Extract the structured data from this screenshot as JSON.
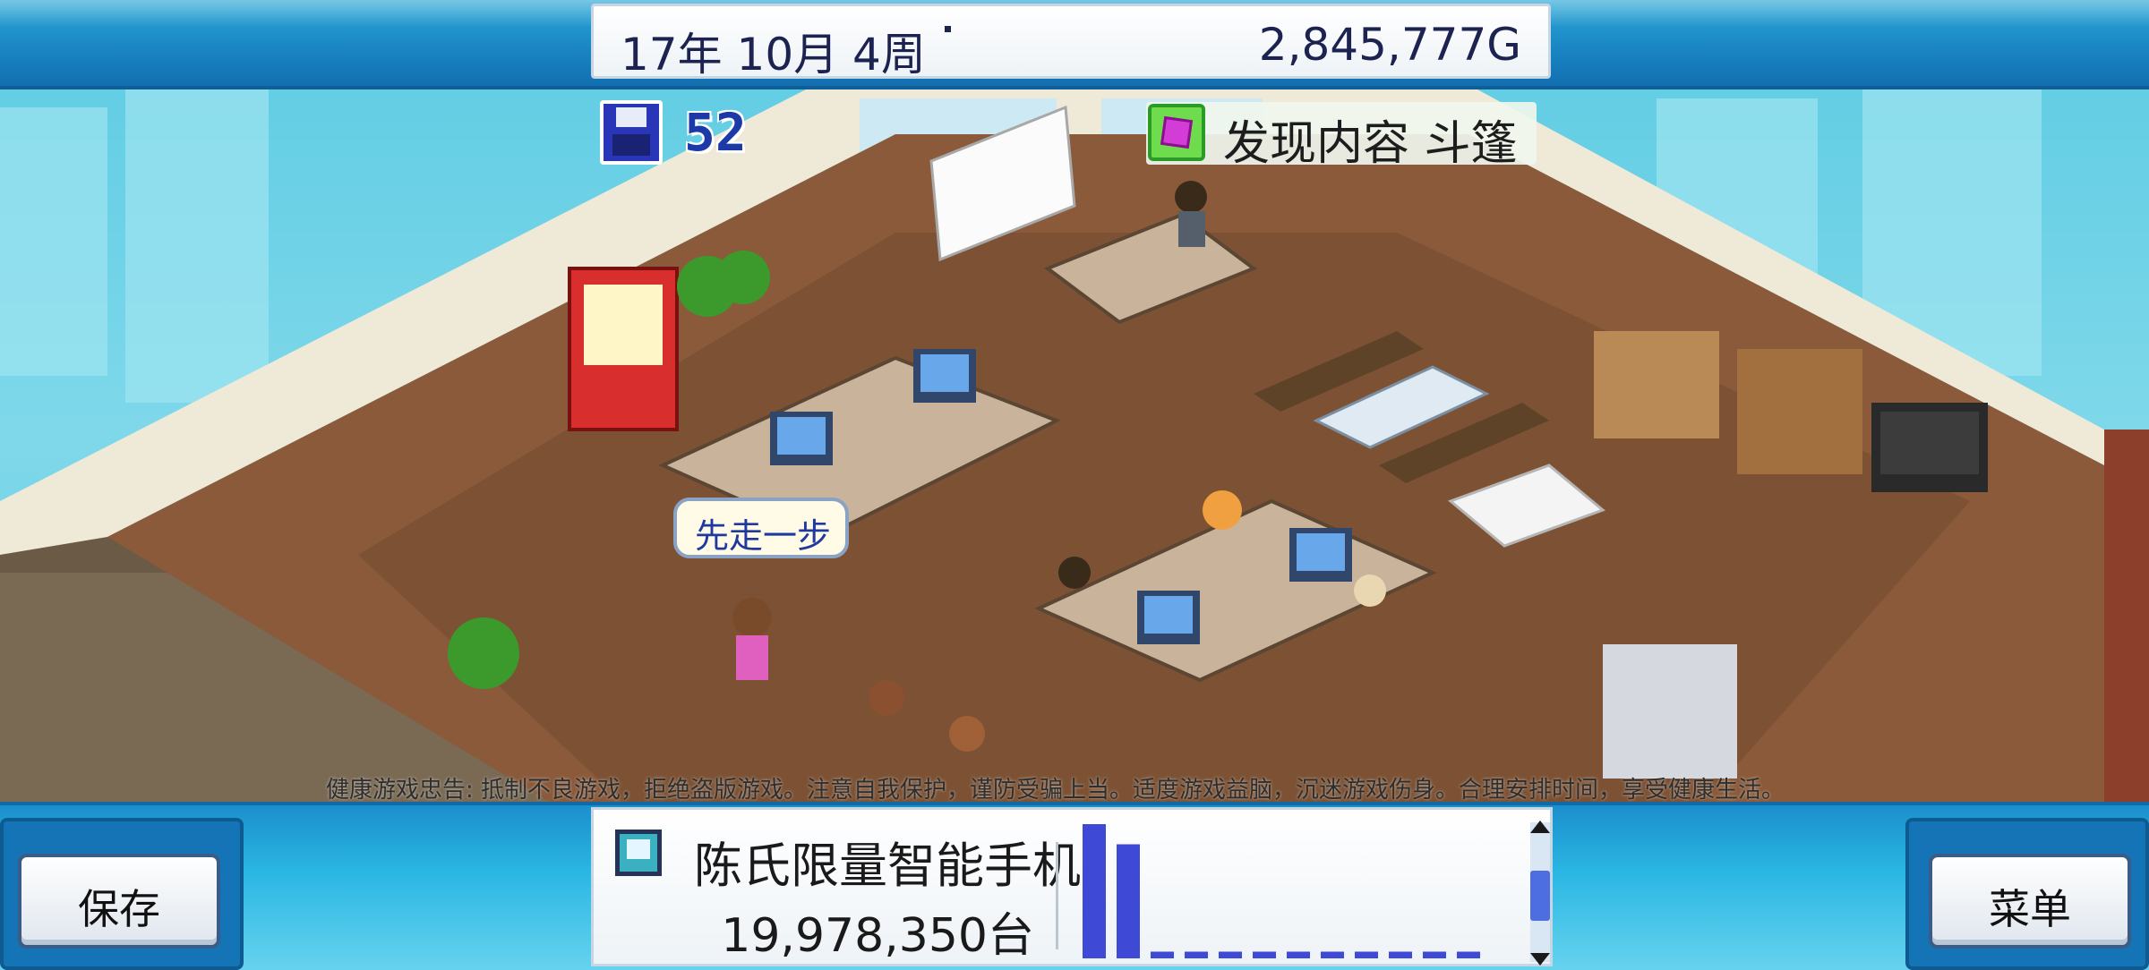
{
  "header": {
    "date": "17年 10月 4周",
    "money": "2,845,777G"
  },
  "save_counter": {
    "icon": "floppy-disk-icon",
    "value": "52"
  },
  "discovery": {
    "icon": "purple-gem-icon",
    "text": "发现内容 斗篷"
  },
  "speech_bubble": {
    "text": "先走一步"
  },
  "warning_text": "健康游戏忠告: 抵制不良游戏，拒绝盗版游戏。注意自我保护，谨防受骗上当。适度游戏益脑，沉迷游戏伤身。合理安排时间，享受健康生活。",
  "bottom_bar": {
    "save_button": "保存",
    "menu_button": "菜单",
    "product": {
      "icon": "console-icon",
      "name": "陈氏限量智能手机",
      "sales": "19,978,350台"
    },
    "sales_chart": {
      "bars": [
        1.0,
        0.85,
        0.05,
        0.05,
        0.05,
        0.05,
        0.05,
        0.05,
        0.05,
        0.05,
        0.05,
        0.05
      ],
      "scroll_position": 0.55
    }
  },
  "colors": {
    "topbar": "#1a86c4",
    "bar_fill": "#3e49d6",
    "text_dark": "#1c2350",
    "save_number": "#1b3aa8"
  }
}
